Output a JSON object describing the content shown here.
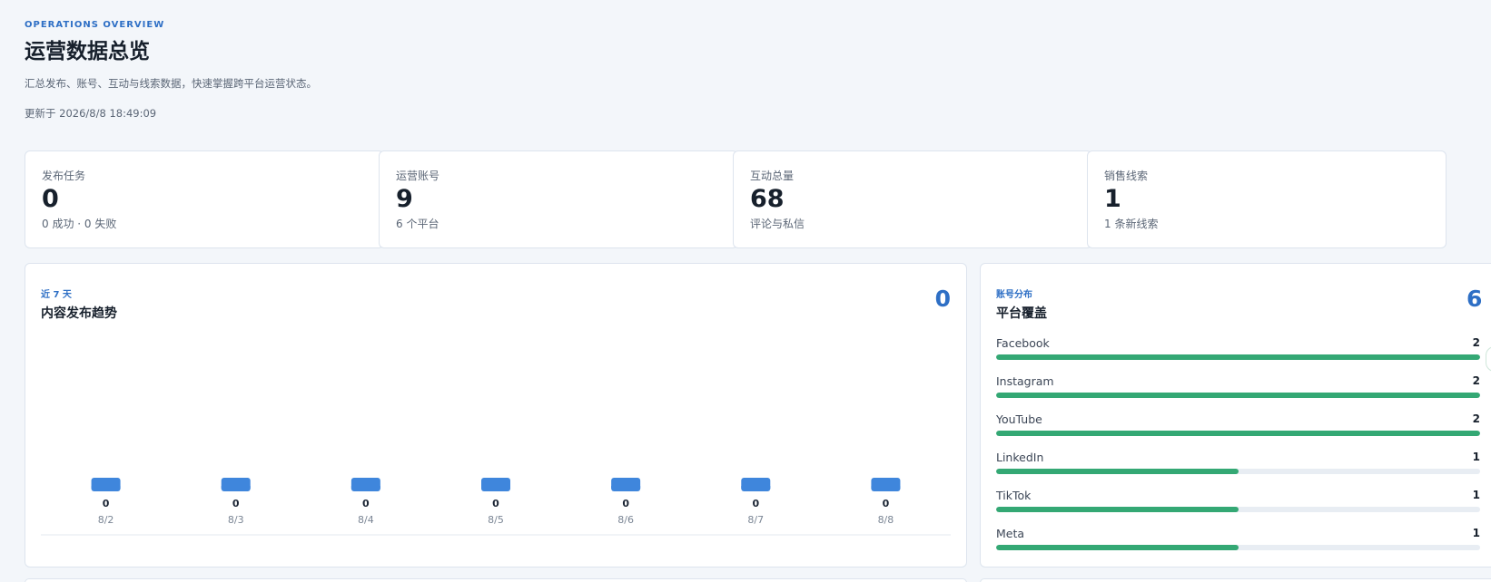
{
  "header": {
    "eyebrow": "OPERATIONS OVERVIEW",
    "title": "运营数据总览",
    "subtitle": "汇总发布、账号、互动与线索数据，快速掌握跨平台运营状态。",
    "updated": "更新于 2026/8/8 18:49:09"
  },
  "stats": [
    {
      "label": "发布任务",
      "value": "0",
      "sub": "0 成功 · 0 失败"
    },
    {
      "label": "运营账号",
      "value": "9",
      "sub": "6 个平台"
    },
    {
      "label": "互动总量",
      "value": "68",
      "sub": "评论与私信"
    },
    {
      "label": "销售线索",
      "value": "1",
      "sub": "1 条新线索"
    }
  ],
  "trend": {
    "eyebrow": "近 7 天",
    "title": "内容发布趋势",
    "total": "0"
  },
  "chart_data": {
    "type": "bar",
    "categories": [
      "8/2",
      "8/3",
      "8/4",
      "8/5",
      "8/6",
      "8/7",
      "8/8"
    ],
    "values": [
      0,
      0,
      0,
      0,
      0,
      0,
      0
    ],
    "value_labels": [
      "0",
      "0",
      "0",
      "0",
      "0",
      "0",
      "0"
    ],
    "bar_color": "#3f86dc"
  },
  "platforms": {
    "eyebrow": "账号分布",
    "title": "平台覆盖",
    "total": "6",
    "items": [
      {
        "name": "Facebook",
        "count": "2",
        "share": 1.0
      },
      {
        "name": "Instagram",
        "count": "2",
        "share": 1.0
      },
      {
        "name": "YouTube",
        "count": "2",
        "share": 1.0
      },
      {
        "name": "LinkedIn",
        "count": "1",
        "share": 0.5
      },
      {
        "name": "TikTok",
        "count": "1",
        "share": 0.5
      },
      {
        "name": "Meta",
        "count": "1",
        "share": 0.5
      }
    ],
    "bar_color": "#34a874"
  },
  "colors": {
    "accent": "#2e6fc5",
    "background": "#f3f6fa"
  }
}
